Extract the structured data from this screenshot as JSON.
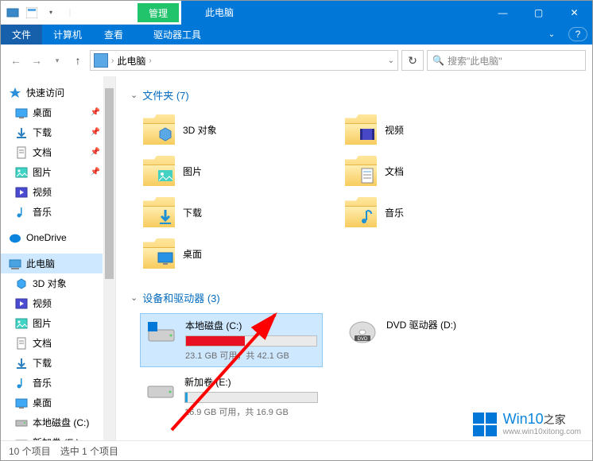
{
  "window": {
    "context_tab": "管理",
    "title": "此电脑",
    "min": "—",
    "max": "▢",
    "close": "✕"
  },
  "ribbon": {
    "file": "文件",
    "computer": "计算机",
    "view": "查看",
    "drive_tools": "驱动器工具"
  },
  "address": {
    "path_root": "此电脑",
    "back": "←",
    "forward": "→",
    "up": "↑",
    "refresh": "↻"
  },
  "search": {
    "placeholder": "搜索\"此电脑\"",
    "icon": "🔍"
  },
  "sidebar": {
    "quick_access": "快速访问",
    "items_qa": [
      {
        "label": "桌面",
        "pinned": true,
        "icon": "desktop"
      },
      {
        "label": "下载",
        "pinned": true,
        "icon": "downloads"
      },
      {
        "label": "文档",
        "pinned": true,
        "icon": "documents"
      },
      {
        "label": "图片",
        "pinned": true,
        "icon": "pictures"
      },
      {
        "label": "视频",
        "pinned": false,
        "icon": "videos"
      },
      {
        "label": "音乐",
        "pinned": false,
        "icon": "music"
      }
    ],
    "onedrive": "OneDrive",
    "this_pc": "此电脑",
    "items_pc": [
      {
        "label": "3D 对象",
        "icon": "3d"
      },
      {
        "label": "视频",
        "icon": "videos"
      },
      {
        "label": "图片",
        "icon": "pictures"
      },
      {
        "label": "文档",
        "icon": "documents"
      },
      {
        "label": "下载",
        "icon": "downloads"
      },
      {
        "label": "音乐",
        "icon": "music"
      },
      {
        "label": "桌面",
        "icon": "desktop"
      },
      {
        "label": "本地磁盘 (C:)",
        "icon": "drive"
      },
      {
        "label": "新加卷 (E:)",
        "icon": "drive"
      }
    ]
  },
  "content": {
    "folders_header": "文件夹 (7)",
    "folders": [
      {
        "label": "3D 对象",
        "overlay": "3d"
      },
      {
        "label": "视频",
        "overlay": "video"
      },
      {
        "label": "图片",
        "overlay": "picture"
      },
      {
        "label": "文档",
        "overlay": "document"
      },
      {
        "label": "下载",
        "overlay": "download"
      },
      {
        "label": "音乐",
        "overlay": "music"
      },
      {
        "label": "桌面",
        "overlay": "desktop"
      }
    ],
    "drives_header": "设备和驱动器 (3)",
    "drives": [
      {
        "name": "本地磁盘 (C:)",
        "stats": "23.1 GB 可用，共 42.1 GB",
        "used_frac": 0.45,
        "selected": true,
        "fill_color": "#e81123",
        "icon": "hdd-win"
      },
      {
        "name": "DVD 驱动器 (D:)",
        "stats": "",
        "used_frac": null,
        "selected": false,
        "fill_color": "",
        "icon": "dvd"
      },
      {
        "name": "新加卷 (E:)",
        "stats": "16.9 GB 可用，共 16.9 GB",
        "used_frac": 0.02,
        "selected": false,
        "fill_color": "#26a0da",
        "icon": "hdd"
      }
    ]
  },
  "statusbar": {
    "item_count": "10 个项目",
    "selected_count": "选中 1 个项目"
  },
  "watermark": {
    "brand": "Win10",
    "home": "之家",
    "url": "www.win10xitong.com"
  }
}
